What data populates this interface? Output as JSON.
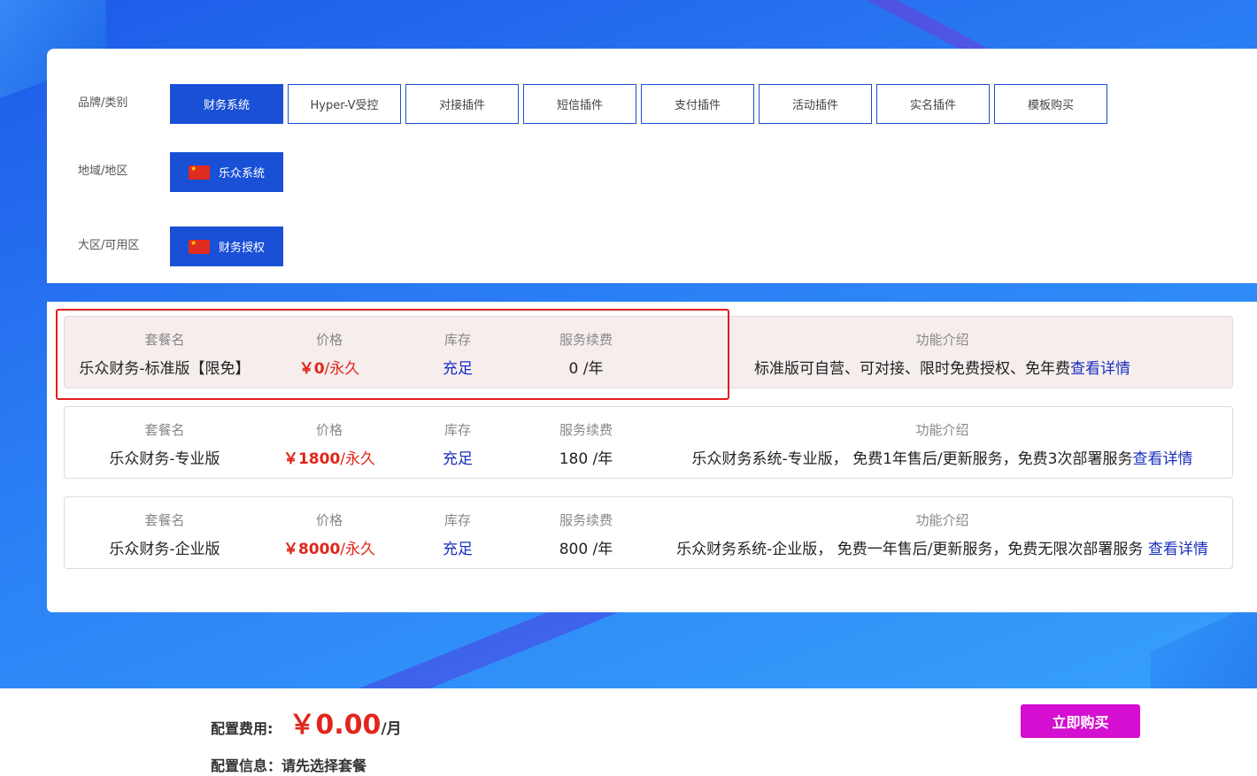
{
  "filters": [
    {
      "label": "品牌/类别",
      "options": [
        "财务系统",
        "Hyper-V受控",
        "对接插件",
        "短信插件",
        "支付插件",
        "活动插件",
        "实名插件",
        "模板购买"
      ]
    },
    {
      "label": "地域/地区",
      "options": [
        "乐众系统"
      ]
    },
    {
      "label": "大区/可用区",
      "options": [
        "财务授权"
      ]
    }
  ],
  "plans": [
    {
      "h_name": "套餐名",
      "h_price": "价格",
      "h_stock": "库存",
      "h_renew": "服务续费",
      "h_feature": "功能介绍",
      "name": "乐众财务-标准版【限免】",
      "price": "￥0",
      "price_unit": "/永久",
      "stock": "充足",
      "renew": "0 /年",
      "feature": "标准版可自营、可对接、限时免费授权、免年费",
      "detail_link": "查看详情"
    },
    {
      "h_name": "套餐名",
      "h_price": "价格",
      "h_stock": "库存",
      "h_renew": "服务续费",
      "h_feature": "功能介绍",
      "name": "乐众财务-专业版",
      "price": "￥1800",
      "price_unit": "/永久",
      "stock": "充足",
      "renew": "180 /年",
      "feature": "乐众财务系统-专业版， 免费1年售后/更新服务，免费3次部署服务",
      "detail_link": "查看详情"
    },
    {
      "h_name": "套餐名",
      "h_price": "价格",
      "h_stock": "库存",
      "h_renew": "服务续费",
      "h_feature": "功能介绍",
      "name": "乐众财务-企业版",
      "price": "￥8000",
      "price_unit": "/永久",
      "stock": "充足",
      "renew": "800 /年",
      "feature": "乐众财务系统-企业版， 免费一年售后/更新服务，免费无限次部署服务 ",
      "detail_link": "查看详情"
    }
  ],
  "footer": {
    "fee_label": "配置费用:",
    "fee_amount": "￥0.00",
    "fee_unit": "/月",
    "info": "配置信息：请先选择套餐",
    "buy_label": "立即购买"
  },
  "colors": {
    "primary_blue": "#1950d6",
    "price_red": "#e0261b",
    "buy_magenta": "#d40fd1",
    "highlight_red": "#e21d1d"
  }
}
